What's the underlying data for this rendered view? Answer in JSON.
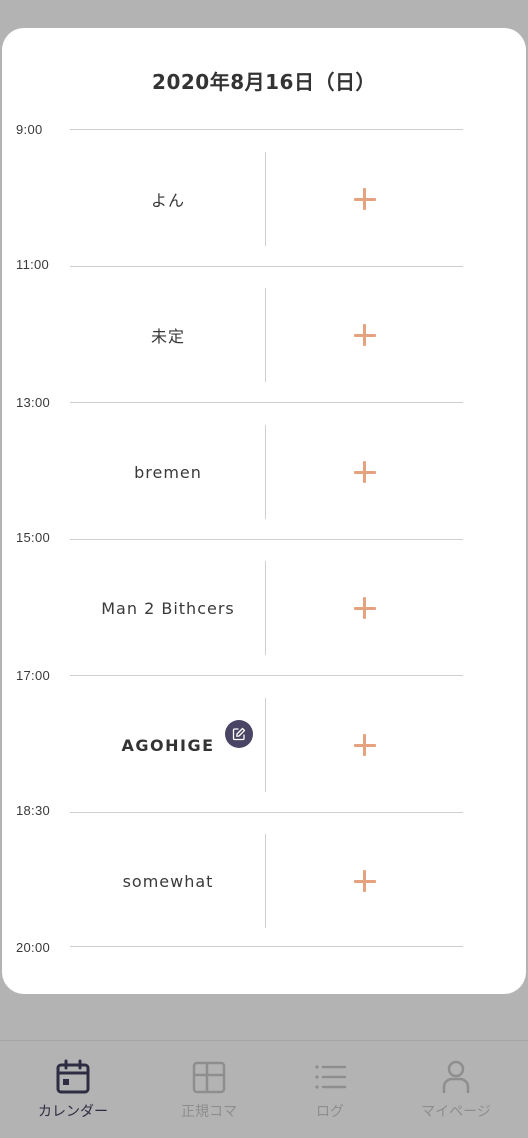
{
  "header": {
    "date_title": "2020年8月16日（日）"
  },
  "time_labels": [
    "9:00",
    "11:00",
    "13:00",
    "15:00",
    "17:00",
    "18:30",
    "20:00"
  ],
  "slots": [
    {
      "name": "よん"
    },
    {
      "name": "未定"
    },
    {
      "name": "bremen"
    },
    {
      "name": "Man 2 Bithcers"
    },
    {
      "name": "AGOHIGE"
    },
    {
      "name": "somewhat"
    }
  ],
  "icons": {
    "add": "plus-icon",
    "edit": "pencil-edit-icon",
    "calendar": "calendar-icon",
    "regular": "grid-icon",
    "log": "list-icon",
    "mypage": "person-icon"
  },
  "tabbar": {
    "calendar_label": "カレンダー",
    "regular_label": "正規コマ",
    "log_label": "ログ",
    "mypage_label": "マイページ"
  },
  "colors": {
    "accent_plus": "#e5a27f",
    "active_tab": "#2e2c42",
    "inactive_tab": "#8e8e8e",
    "edit_badge": "#4a4564",
    "backdrop": "#b3b3b3"
  }
}
